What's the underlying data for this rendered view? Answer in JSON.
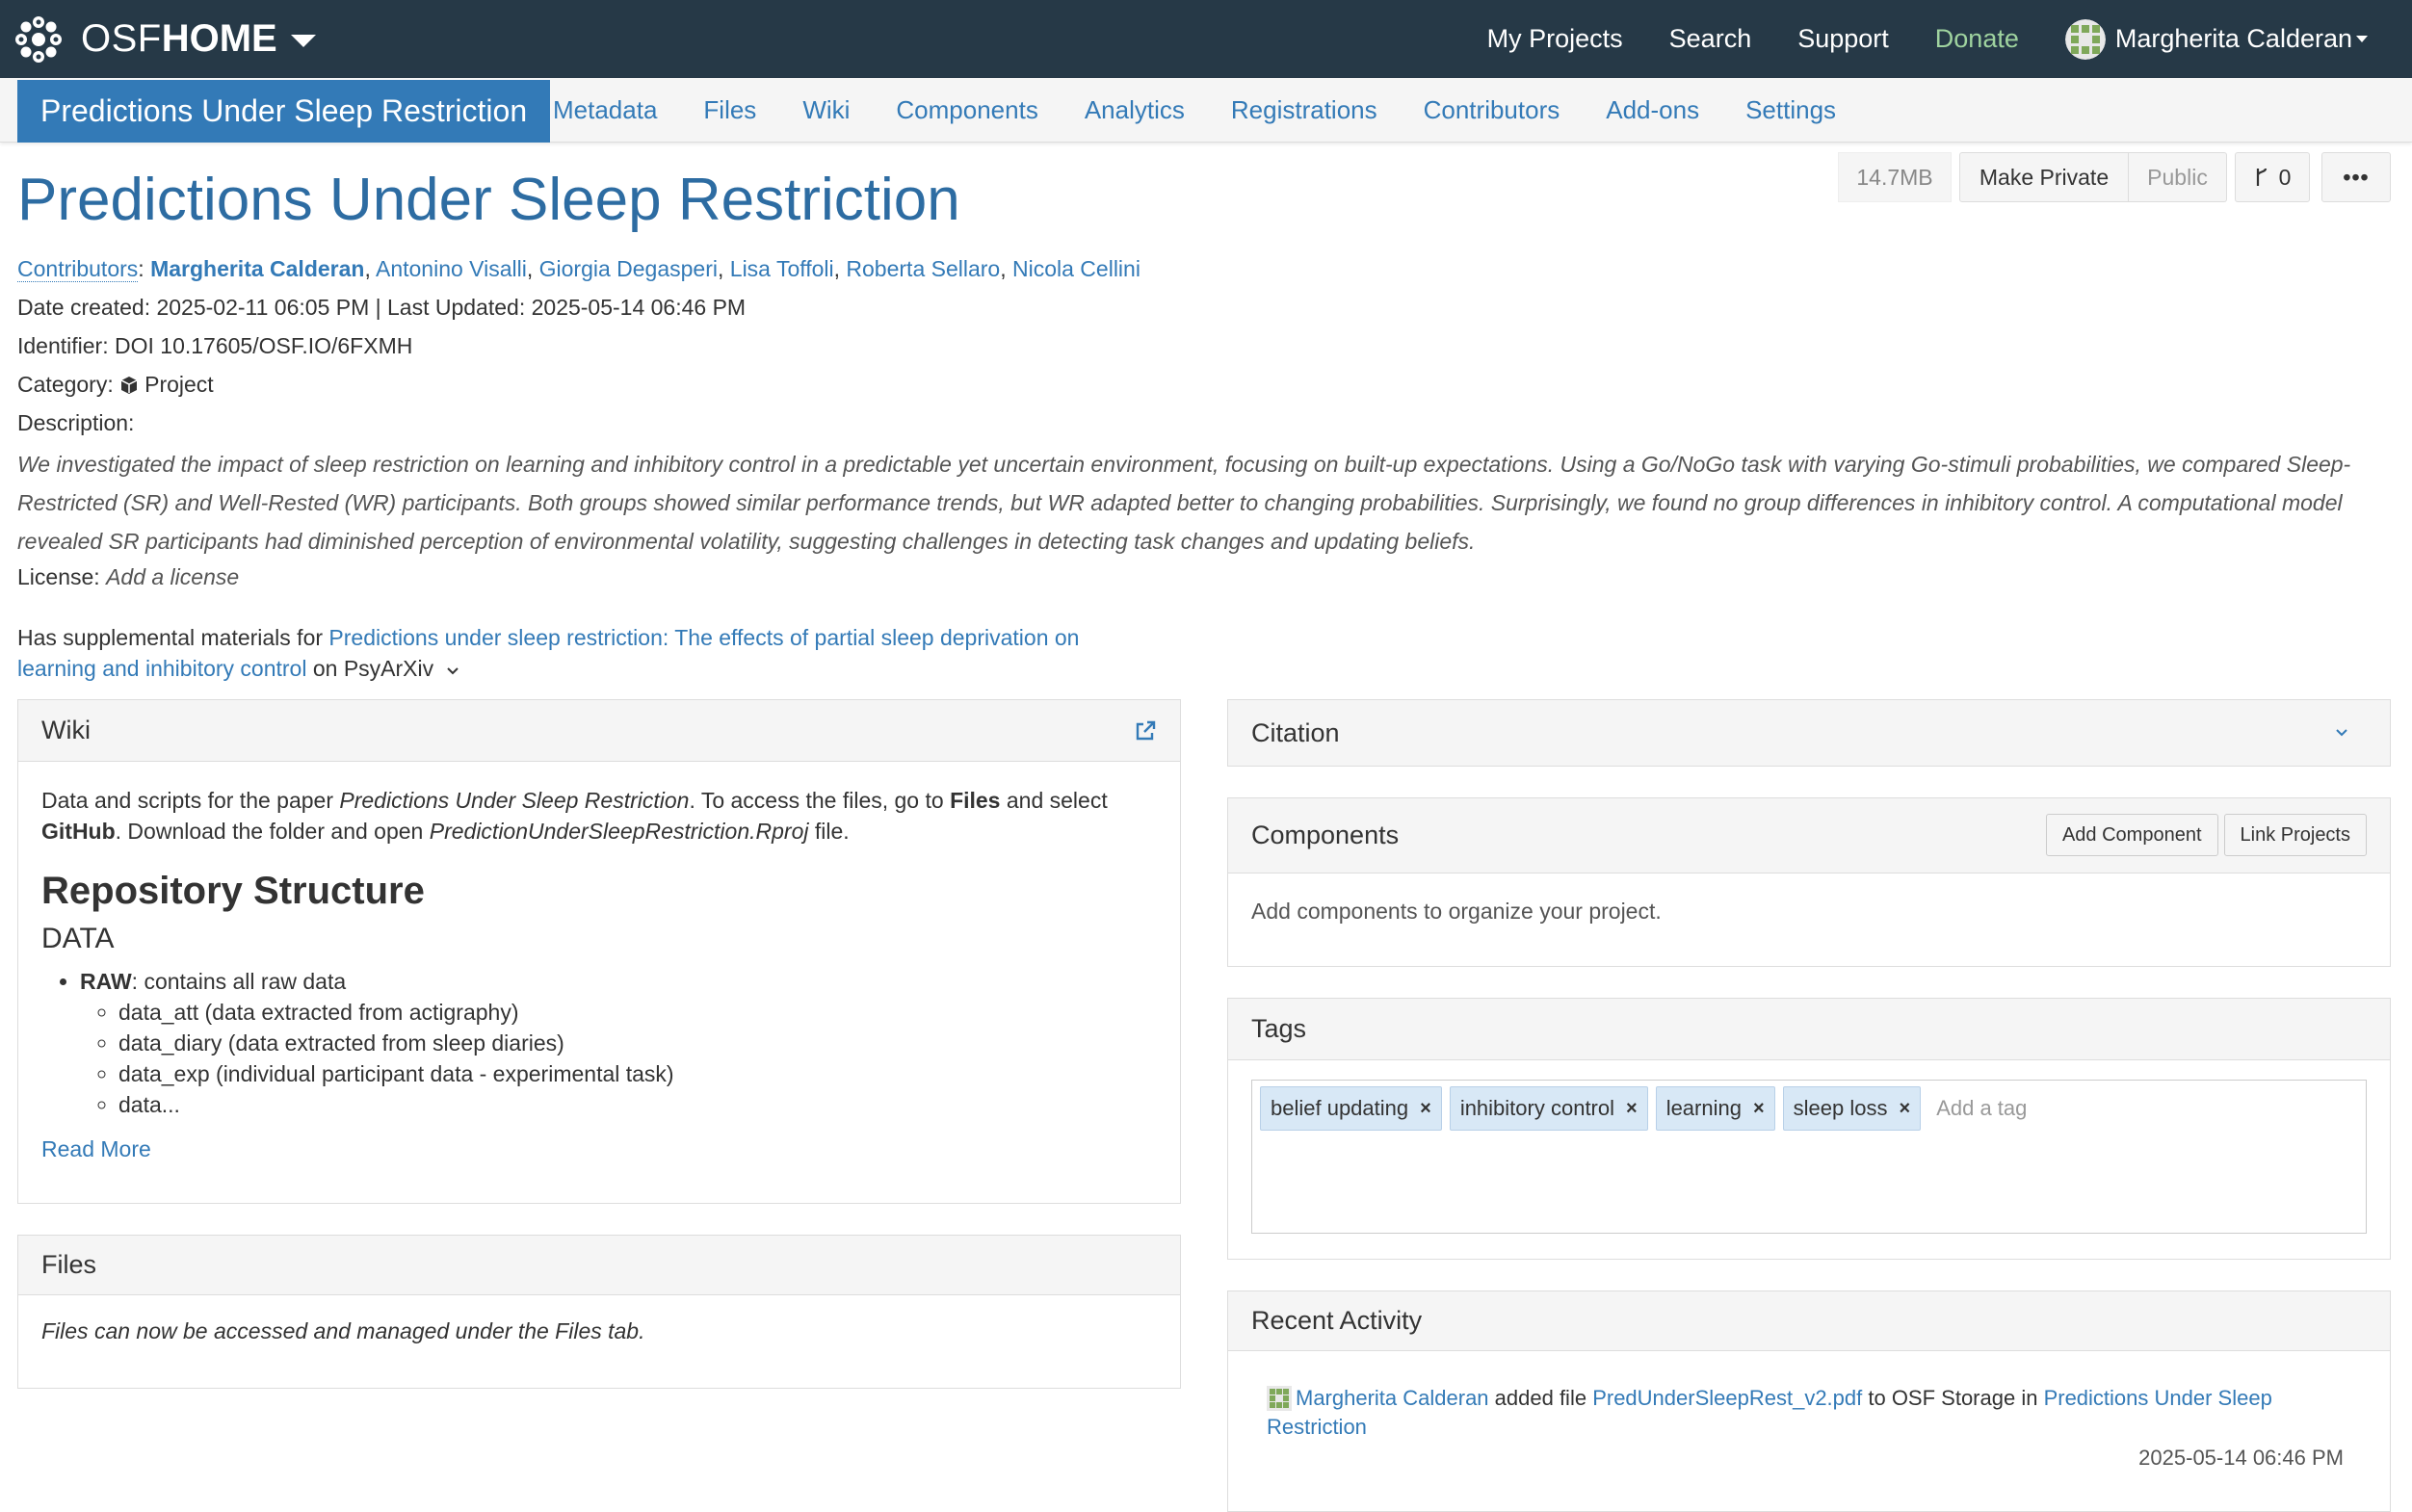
{
  "topnav": {
    "brand_osf": "OSF",
    "brand_home": "HOME",
    "links": [
      "My Projects",
      "Search",
      "Support",
      "Donate"
    ],
    "user_name": "Margherita Calderan"
  },
  "projnav": {
    "title": "Predictions Under Sleep Restriction",
    "tabs": [
      "Metadata",
      "Files",
      "Wiki",
      "Components",
      "Analytics",
      "Registrations",
      "Contributors",
      "Add-ons",
      "Settings"
    ]
  },
  "header": {
    "title": "Predictions Under Sleep Restriction",
    "size": "14.7MB",
    "make_private": "Make Private",
    "public": "Public",
    "forks_icon": "fork-icon",
    "forks_count": "0",
    "more": "•••"
  },
  "meta": {
    "contributors_label": "Contributors",
    "contributors": [
      "Margherita Calderan",
      "Antonino Visalli",
      "Giorgia Degasperi",
      "Lisa Toffoli",
      "Roberta Sellaro",
      "Nicola Cellini"
    ],
    "dates": "Date created: 2025-02-11 06:05 PM | Last Updated: 2025-05-14 06:46 PM",
    "identifier": "Identifier: DOI 10.17605/OSF.IO/6FXMH",
    "category_label": "Category:",
    "category_value": "Project",
    "description_label": "Description:",
    "description": "We investigated the impact of sleep restriction on learning and inhibitory control in a predictable yet uncertain environment, focusing on built-up expectations. Using a Go/NoGo task with varying Go-stimuli probabilities, we compared Sleep-Restricted (SR) and Well-Rested (WR) participants. Both groups showed similar performance trends, but WR adapted better to changing probabilities. Surprisingly, we found no group differences in inhibitory control. A computational model revealed SR participants had diminished perception of environmental volatility, suggesting challenges in detecting task changes and updating beliefs.",
    "license_label": "License:",
    "license_value": "Add a license",
    "supplemental_prefix": "Has supplemental materials for",
    "supplemental_link_line1": "Predictions under sleep restriction: The effects of partial sleep deprivation on",
    "supplemental_link_line2": "learning and inhibitory control",
    "supplemental_suffix": "on PsyArXiv"
  },
  "wiki": {
    "header": "Wiki",
    "intro_1": "Data and scripts for the paper ",
    "intro_paper": "Predictions Under Sleep Restriction",
    "intro_2": ". To access the files, go to ",
    "intro_files": "Files",
    "intro_3": " and select",
    "intro_github": "GitHub",
    "intro_4": ". Download the folder and open ",
    "intro_rproj": "PredictionUnderSleepRestriction.Rproj",
    "intro_5": " file.",
    "h2": "Repository Structure",
    "h3": "DATA",
    "raw_bold": "RAW",
    "raw_text": ": contains all raw data",
    "sub_items": [
      "data_att (data extracted from actigraphy)",
      "data_diary (data extracted from sleep diaries)",
      "data_exp (individual participant data - experimental task)",
      "data..."
    ],
    "read_more": "Read More"
  },
  "files_panel": {
    "header": "Files",
    "body": "Files can now be accessed and managed under the Files tab."
  },
  "citation": {
    "header": "Citation"
  },
  "components": {
    "header": "Components",
    "add": "Add Component",
    "link": "Link Projects",
    "body": "Add components to organize your project."
  },
  "tags": {
    "header": "Tags",
    "items": [
      "belief updating",
      "inhibitory control",
      "learning",
      "sleep loss"
    ],
    "placeholder": "Add a tag"
  },
  "activity": {
    "header": "Recent Activity",
    "user": "Margherita Calderan",
    "action": " added file ",
    "file": "PredUnderSleepRest_v2.pdf",
    "middle": " to OSF Storage in ",
    "project_line1": "Predictions Under Sleep",
    "project_line2": "Restriction",
    "timestamp": "2025-05-14 06:46 PM"
  }
}
